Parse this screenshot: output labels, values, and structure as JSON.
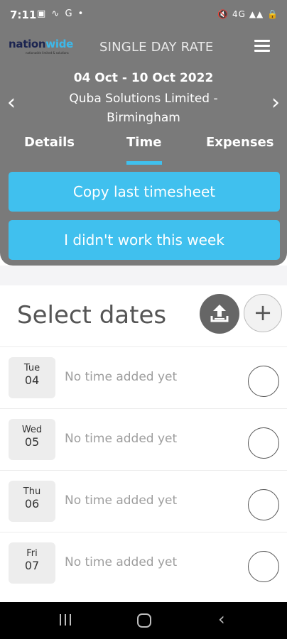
{
  "status": {
    "time": "7:11",
    "left_icons": "▣ ∿ G •",
    "right_icons": "🔇 4G ▲▲ 🔒"
  },
  "logo": {
    "part1": "nation",
    "part2": "wide",
    "tagline": "nationwide limited & solutions"
  },
  "header": {
    "title": "SINGLE DAY RATE",
    "period": "04 Oct - 10 Oct 2022",
    "client": "Quba Solutions Limited - Birmingham"
  },
  "tabs": [
    {
      "label": "Details"
    },
    {
      "label": "Time"
    },
    {
      "label": "Expenses"
    }
  ],
  "actions": {
    "copy_label": "Copy last timesheet",
    "no_work_label": "I didn't work this week"
  },
  "dates": {
    "title": "Select dates",
    "add_symbol": "+",
    "rows": [
      {
        "day": "Tue",
        "num": "04",
        "status": "No time added yet"
      },
      {
        "day": "Wed",
        "num": "05",
        "status": "No time added yet"
      },
      {
        "day": "Thu",
        "num": "06",
        "status": "No time added yet"
      },
      {
        "day": "Fri",
        "num": "07",
        "status": "No time added yet"
      }
    ]
  },
  "colors": {
    "header_bg": "#7a7a7a",
    "accent": "#40c0ee",
    "brand_navy": "#1b2450"
  },
  "icons": {
    "menu": "hamburger-menu-icon",
    "prev": "chevron-left-icon",
    "next": "chevron-right-icon",
    "upload": "upload-icon",
    "add": "plus-icon",
    "check": "checkbox-circle-icon"
  }
}
